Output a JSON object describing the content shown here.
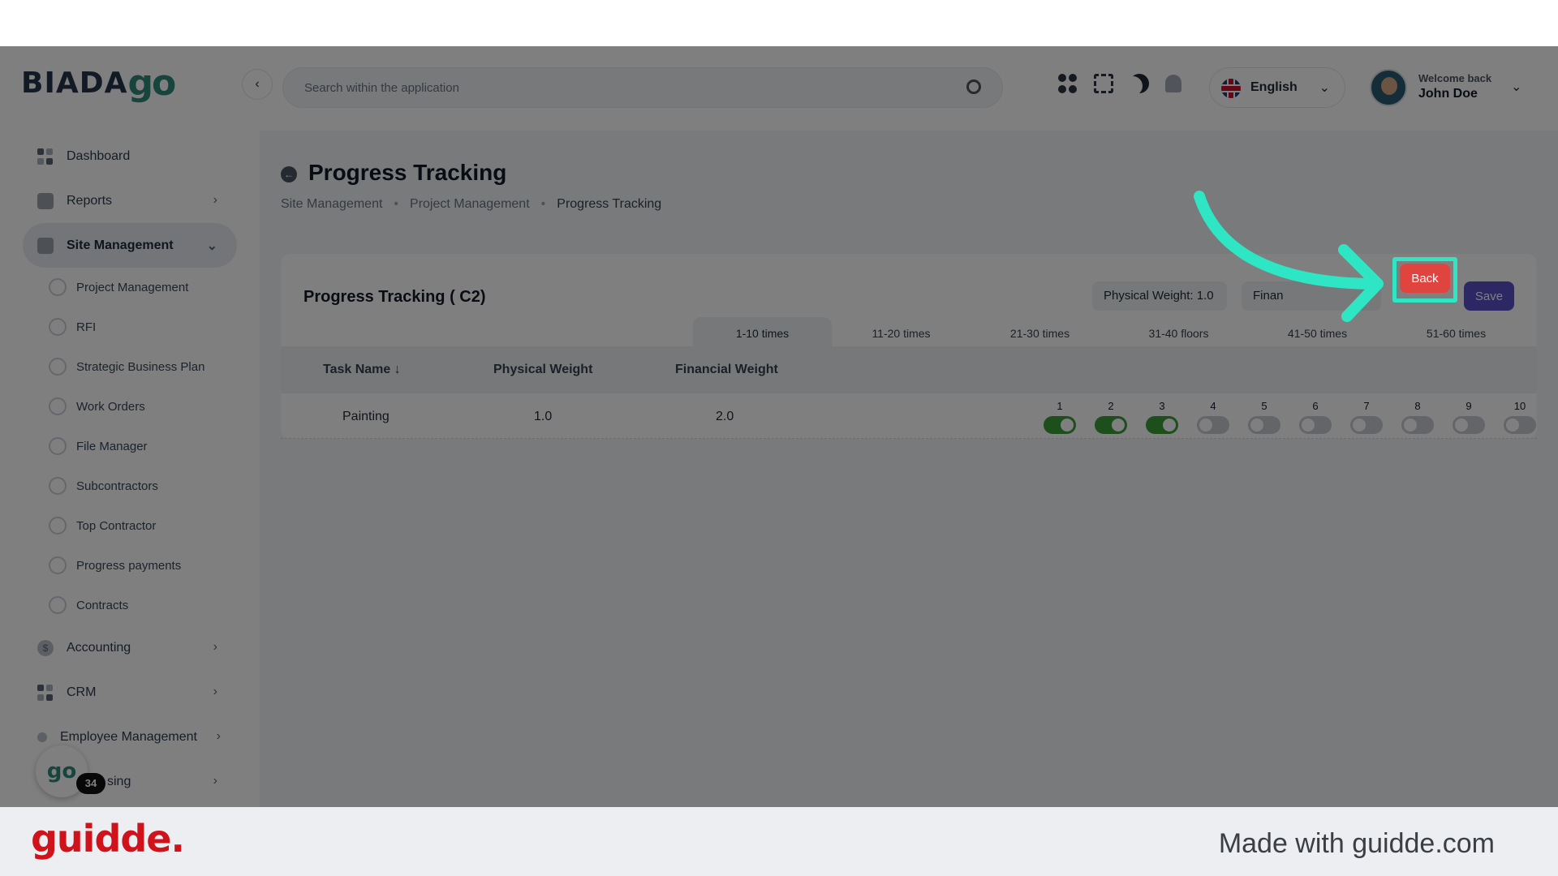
{
  "brand": {
    "logo_main": "BIADA",
    "logo_go": "go"
  },
  "sidebar": {
    "items": [
      {
        "label": "Dashboard"
      },
      {
        "label": "Reports"
      },
      {
        "label": "Site Management"
      },
      {
        "label": "Accounting"
      },
      {
        "label": "CRM"
      },
      {
        "label": "Employee Management"
      },
      {
        "label": "sing"
      }
    ],
    "site_management_children": [
      "Project Management",
      "RFI",
      "Strategic Business Plan",
      "Work Orders",
      "File Manager",
      "Subcontractors",
      "Top Contractor",
      "Progress payments",
      "Contracts"
    ],
    "go_badge": "go",
    "count_badge": "34"
  },
  "header": {
    "collapse_icon": "chevron-left-icon",
    "search_placeholder": "Search within the application",
    "language": "English",
    "welcome": "Welcome back",
    "user_name": "John Doe"
  },
  "page": {
    "title": "Progress Tracking",
    "breadcrumb": [
      "Site Management",
      "Project Management",
      "Progress Tracking"
    ]
  },
  "card": {
    "title": "Progress Tracking ( C2)",
    "physical_weight_pill": "Physical Weight: 1.0",
    "financial_weight_pill": "Finan",
    "back_label": "Back",
    "save_label": "Save",
    "tabs": [
      "1-10 times",
      "11-20 times",
      "21-30 times",
      "31-40 floors",
      "41-50 times",
      "51-60 times"
    ],
    "active_tab": 0,
    "columns": [
      "Task Name",
      "Physical Weight",
      "Financial Weight"
    ],
    "rows": [
      {
        "task": "Painting",
        "physical": "1.0",
        "financial": "2.0"
      }
    ],
    "toggles": [
      {
        "n": "1",
        "on": true
      },
      {
        "n": "2",
        "on": true
      },
      {
        "n": "3",
        "on": true
      },
      {
        "n": "4",
        "on": false
      },
      {
        "n": "5",
        "on": false
      },
      {
        "n": "6",
        "on": false
      },
      {
        "n": "7",
        "on": false
      },
      {
        "n": "8",
        "on": false
      },
      {
        "n": "9",
        "on": false
      },
      {
        "n": "10",
        "on": false
      }
    ]
  },
  "footer": {
    "logo": "guidde.",
    "made_with": "Made with guidde.com"
  },
  "colors": {
    "accent_highlight": "#2ee6c3",
    "back_button": "#e0443f",
    "save_button": "#5b4fc9",
    "toggle_on": "#3b9e3b"
  }
}
